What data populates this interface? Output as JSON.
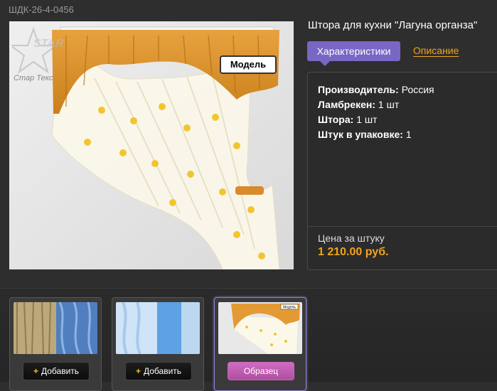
{
  "sku": "ШДК-26-4-0456",
  "product": {
    "title": "Штора для кухни \"Лагуна органза\"",
    "model_tag": "Модель",
    "logo_text": "Стар Текс"
  },
  "tabs": {
    "active": "Характеристики",
    "link": "Описание"
  },
  "specs": [
    {
      "label": "Производитель:",
      "value": "Россия"
    },
    {
      "label": "Ламбрекен:",
      "value": "1 шт"
    },
    {
      "label": "Штора:",
      "value": "1 шт"
    },
    {
      "label": "Штук в упаковке:",
      "value": "1"
    }
  ],
  "price": {
    "label": "Цена за штуку",
    "value": "1 210.00 руб."
  },
  "thumbnails": [
    {
      "button": "Добавить",
      "icon": "plus-icon"
    },
    {
      "button": "Добавить",
      "icon": "plus-icon"
    },
    {
      "button": "Образец",
      "thumb_tag": "Модель"
    }
  ],
  "colors": {
    "accent_purple": "#7a66c4",
    "link_orange": "#f0a41a",
    "sample_pink": "#c05ab0"
  }
}
